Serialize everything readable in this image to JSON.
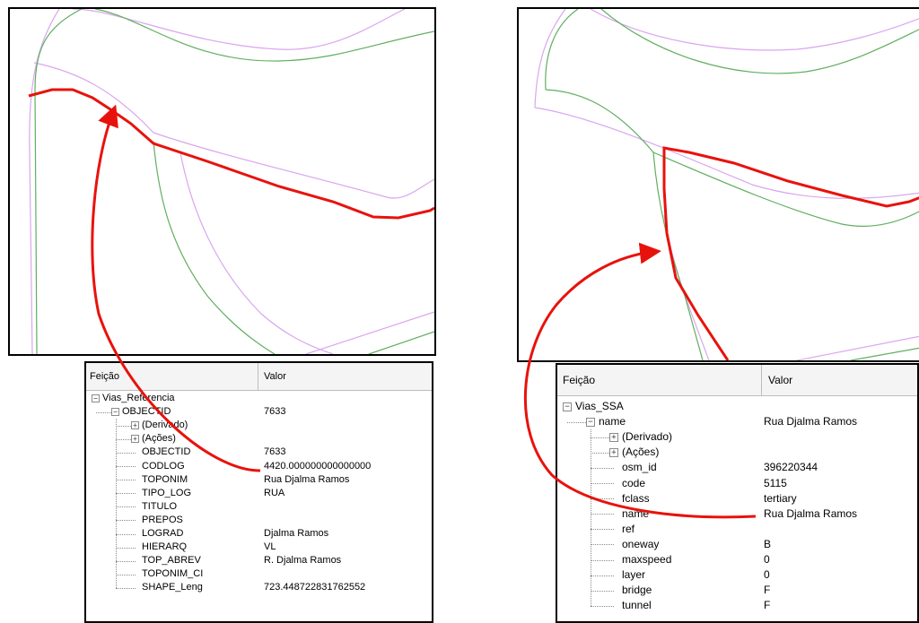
{
  "left_panel": {
    "header": {
      "feature": "Feição",
      "value": "Valor"
    },
    "rows": [
      {
        "level": 0,
        "expander": "−",
        "key": "Vias_Referencia",
        "value": ""
      },
      {
        "level": 1,
        "expander": "−",
        "key": "OBJECTID",
        "value": "7633"
      },
      {
        "level": 2,
        "expander": "+",
        "key": "(Derivado)",
        "value": ""
      },
      {
        "level": 2,
        "expander": "+",
        "key": "(Ações)",
        "value": ""
      },
      {
        "level": 2,
        "expander": "",
        "key": "OBJECTID",
        "value": "7633"
      },
      {
        "level": 2,
        "expander": "",
        "key": "CODLOG",
        "value": "4420.000000000000000"
      },
      {
        "level": 2,
        "expander": "",
        "key": "TOPONIM",
        "value": "Rua Djalma Ramos"
      },
      {
        "level": 2,
        "expander": "",
        "key": "TIPO_LOG",
        "value": "RUA"
      },
      {
        "level": 2,
        "expander": "",
        "key": "TITULO",
        "value": ""
      },
      {
        "level": 2,
        "expander": "",
        "key": "PREPOS",
        "value": ""
      },
      {
        "level": 2,
        "expander": "",
        "key": "LOGRAD",
        "value": "Djalma Ramos"
      },
      {
        "level": 2,
        "expander": "",
        "key": "HIERARQ",
        "value": "VL"
      },
      {
        "level": 2,
        "expander": "",
        "key": "TOP_ABREV",
        "value": "R. Djalma Ramos"
      },
      {
        "level": 2,
        "expander": "",
        "key": "TOPONIM_CI",
        "value": ""
      },
      {
        "level": 2,
        "expander": "",
        "key": "SHAPE_Leng",
        "value": "723.448722831762552"
      }
    ]
  },
  "right_panel": {
    "header": {
      "feature": "Feição",
      "value": "Valor"
    },
    "rows": [
      {
        "level": 0,
        "expander": "−",
        "key": "Vias_SSA",
        "value": ""
      },
      {
        "level": 1,
        "expander": "−",
        "key": "name",
        "value": "Rua Djalma Ramos"
      },
      {
        "level": 2,
        "expander": "+",
        "key": "(Derivado)",
        "value": ""
      },
      {
        "level": 2,
        "expander": "+",
        "key": "(Ações)",
        "value": ""
      },
      {
        "level": 2,
        "expander": "",
        "key": "osm_id",
        "value": "396220344"
      },
      {
        "level": 2,
        "expander": "",
        "key": "code",
        "value": "5115"
      },
      {
        "level": 2,
        "expander": "",
        "key": "fclass",
        "value": "tertiary"
      },
      {
        "level": 2,
        "expander": "",
        "key": "name",
        "value": "Rua Djalma Ramos"
      },
      {
        "level": 2,
        "expander": "",
        "key": "ref",
        "value": ""
      },
      {
        "level": 2,
        "expander": "",
        "key": "oneway",
        "value": "B"
      },
      {
        "level": 2,
        "expander": "",
        "key": "maxspeed",
        "value": "0"
      },
      {
        "level": 2,
        "expander": "",
        "key": "layer",
        "value": "0"
      },
      {
        "level": 2,
        "expander": "",
        "key": "bridge",
        "value": "F"
      },
      {
        "level": 2,
        "expander": "",
        "key": "tunnel",
        "value": "F"
      }
    ]
  },
  "colors": {
    "selected_road": "#e8120c",
    "road_outline_green": "#5fae5f",
    "road_outline_violet": "#d9a6ee",
    "annotation_arrow": "#e8120c"
  },
  "icons": [
    "collapse-minus-icon",
    "expand-plus-icon",
    "annotation-arrow-icon"
  ]
}
